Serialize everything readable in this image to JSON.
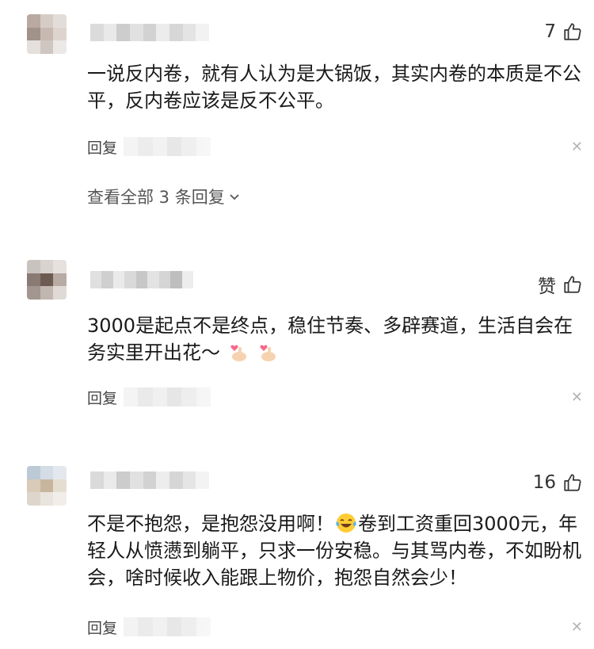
{
  "comments": [
    {
      "like_count": "7",
      "text": "一说反内卷，就有人认为是大锅饭，其实内卷的本质是不公平，反内卷应该是反不公平。",
      "reply_label": "回复",
      "view_all": "查看全部 3 条回复"
    },
    {
      "like_count": "赞",
      "text": "3000是起点不是终点，稳住节奏、多辟赛道，生活自会在务实里开出花～",
      "reply_label": "回复"
    },
    {
      "like_count": "16",
      "text_part1": "不是不抱怨，是抱怨没用啊！",
      "text_part2": "卷到工资重回3000元，年轻人从愤懑到躺平，只求一份安稳。与其骂内卷，不如盼机会，啥时候收入能跟上物价，抱怨自然会少！",
      "reply_label": "回复"
    }
  ],
  "icons": {
    "like": "thumbs-up-icon",
    "close": "close-icon",
    "expand": "chevron-down-icon",
    "heart_hand": "finger-heart-emoji",
    "laugh": "tears-of-joy-emoji"
  }
}
